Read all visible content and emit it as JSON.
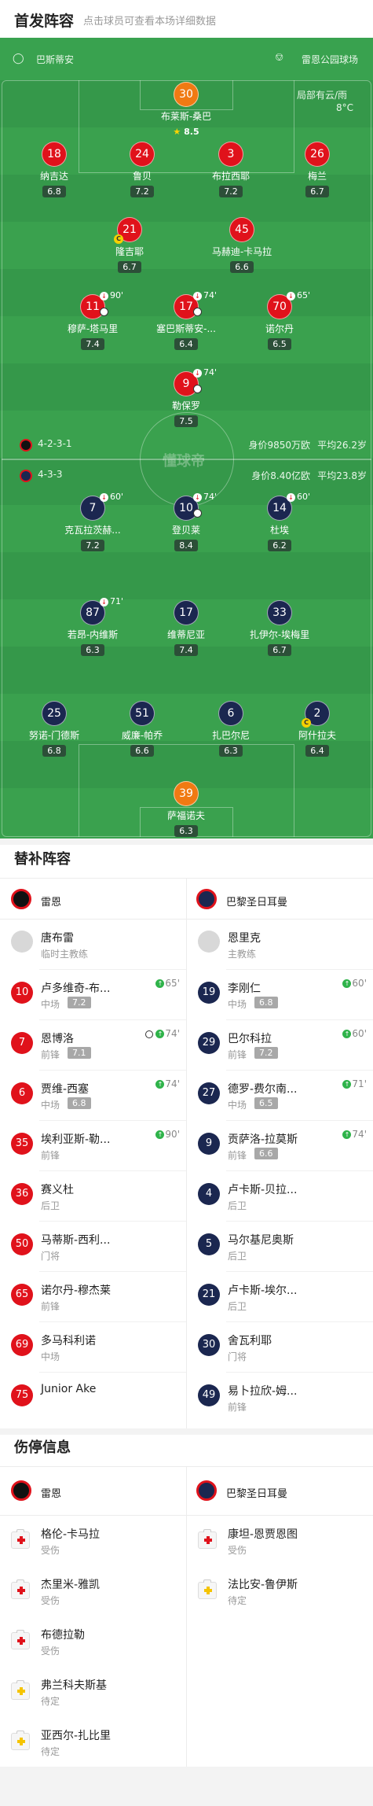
{
  "header": {
    "title": "首发阵容",
    "hint": "点击球员可查看本场详细数据"
  },
  "pitch": {
    "home_team": "巴斯蒂安",
    "away_team": "雷恩公园球场",
    "weather": "局部有云/雨",
    "temperature": "8°C",
    "watermark": "懂球帝",
    "rennes_formation": "4-2-3-1",
    "rennes_value": "身价9850万欧",
    "rennes_age": "平均26.2岁",
    "psg_formation": "4-3-3",
    "psg_value": "身价8.40亿欧",
    "psg_age": "平均23.8岁"
  },
  "rennes_players": [
    {
      "num": "30",
      "name": "布莱斯-桑巴",
      "rating": "8.5"
    },
    {
      "num": "18",
      "name": "纳吉达",
      "rating": "6.8"
    },
    {
      "num": "24",
      "name": "鲁贝",
      "rating": "7.2"
    },
    {
      "num": "3",
      "name": "布拉西耶",
      "rating": "7.2"
    },
    {
      "num": "26",
      "name": "梅兰",
      "rating": "6.7"
    },
    {
      "num": "21",
      "name": "隆吉耶",
      "rating": "6.7"
    },
    {
      "num": "45",
      "name": "马赫迪-卡马拉",
      "rating": "6.6"
    },
    {
      "num": "11",
      "name": "穆萨-塔马里",
      "rating": "7.4",
      "sub": "90'"
    },
    {
      "num": "17",
      "name": "塞巴斯蒂安-...",
      "rating": "6.4",
      "sub": "74'"
    },
    {
      "num": "70",
      "name": "诺尔丹",
      "rating": "6.5",
      "sub": "65'"
    },
    {
      "num": "9",
      "name": "勒保罗",
      "rating": "7.5",
      "sub": "74'"
    }
  ],
  "psg_players": [
    {
      "num": "7",
      "name": "克瓦拉茨赫...",
      "rating": "7.2",
      "sub": "60'"
    },
    {
      "num": "10",
      "name": "登贝莱",
      "rating": "8.4",
      "sub": "74'"
    },
    {
      "num": "14",
      "name": "杜埃",
      "rating": "6.2",
      "sub": "60'"
    },
    {
      "num": "87",
      "name": "若昂-内维斯",
      "rating": "6.3",
      "sub": "71'"
    },
    {
      "num": "17",
      "name": "维蒂尼亚",
      "rating": "7.4"
    },
    {
      "num": "33",
      "name": "扎伊尔-埃梅里",
      "rating": "6.7"
    },
    {
      "num": "25",
      "name": "努诺-门德斯",
      "rating": "6.8"
    },
    {
      "num": "51",
      "name": "威廉-帕乔",
      "rating": "6.6"
    },
    {
      "num": "6",
      "name": "扎巴尔尼",
      "rating": "6.3"
    },
    {
      "num": "2",
      "name": "阿什拉夫",
      "rating": "6.4"
    },
    {
      "num": "39",
      "name": "萨福诺夫",
      "rating": "6.3"
    }
  ],
  "subs": {
    "title": "替补阵容",
    "rennes_name": "雷恩",
    "psg_name": "巴黎圣日耳曼",
    "rennes": [
      {
        "num": "",
        "name": "唐布雷",
        "pos": "临时主教练",
        "rating": "",
        "event": ""
      },
      {
        "num": "10",
        "name": "卢多维奇-布...",
        "pos": "中场",
        "rating": "7.2",
        "event": "65'"
      },
      {
        "num": "7",
        "name": "恩博洛",
        "pos": "前锋",
        "rating": "7.1",
        "event": "74'"
      },
      {
        "num": "6",
        "name": "贾维-西塞",
        "pos": "中场",
        "rating": "6.8",
        "event": "74'"
      },
      {
        "num": "35",
        "name": "埃利亚斯-勒...",
        "pos": "前锋",
        "rating": "",
        "event": "90'"
      },
      {
        "num": "36",
        "name": "赛义杜",
        "pos": "后卫",
        "rating": "",
        "event": ""
      },
      {
        "num": "50",
        "name": "马蒂斯-西利...",
        "pos": "门将",
        "rating": "",
        "event": ""
      },
      {
        "num": "65",
        "name": "诺尔丹-穆杰莱",
        "pos": "前锋",
        "rating": "",
        "event": ""
      },
      {
        "num": "69",
        "name": "多马科利诺",
        "pos": "中场",
        "rating": "",
        "event": ""
      },
      {
        "num": "75",
        "name": "Junior Ake",
        "pos": "",
        "rating": "",
        "event": ""
      }
    ],
    "psg": [
      {
        "num": "",
        "name": "恩里克",
        "pos": "主教练",
        "rating": "",
        "event": ""
      },
      {
        "num": "19",
        "name": "李刚仁",
        "pos": "中场",
        "rating": "6.8",
        "event": "60'"
      },
      {
        "num": "29",
        "name": "巴尔科拉",
        "pos": "前锋",
        "rating": "7.2",
        "event": "60'"
      },
      {
        "num": "27",
        "name": "德罗-费尔南...",
        "pos": "中场",
        "rating": "6.5",
        "event": "71'"
      },
      {
        "num": "9",
        "name": "贡萨洛-拉莫斯",
        "pos": "前锋",
        "rating": "6.6",
        "event": "74'"
      },
      {
        "num": "4",
        "name": "卢卡斯-贝拉...",
        "pos": "后卫",
        "rating": "",
        "event": ""
      },
      {
        "num": "5",
        "name": "马尔基尼奥斯",
        "pos": "后卫",
        "rating": "",
        "event": ""
      },
      {
        "num": "21",
        "name": "卢卡斯-埃尔...",
        "pos": "后卫",
        "rating": "",
        "event": ""
      },
      {
        "num": "30",
        "name": "舍瓦利耶",
        "pos": "门将",
        "rating": "",
        "event": ""
      },
      {
        "num": "49",
        "name": "易卜拉欣-姆...",
        "pos": "前锋",
        "rating": "",
        "event": ""
      }
    ]
  },
  "injuries": {
    "title": "伤停信息",
    "rennes_name": "雷恩",
    "psg_name": "巴黎圣日耳曼",
    "rennes": [
      {
        "name": "格伦-卡马拉",
        "status": "受伤"
      },
      {
        "name": "杰里米-雅凯",
        "status": "受伤"
      },
      {
        "name": "布德拉勒",
        "status": "受伤"
      },
      {
        "name": "弗兰科夫斯基",
        "status": "待定"
      },
      {
        "name": "亚西尔-扎比里",
        "status": "待定"
      }
    ],
    "psg": [
      {
        "name": "康坦-恩贾恩图",
        "status": "受伤"
      },
      {
        "name": "法比安-鲁伊斯",
        "status": "待定"
      }
    ]
  },
  "colors": {
    "rennes": "#e0121b",
    "psg": "#1b2750",
    "gk": "#f07a13",
    "pitch": "#3aa14e"
  }
}
